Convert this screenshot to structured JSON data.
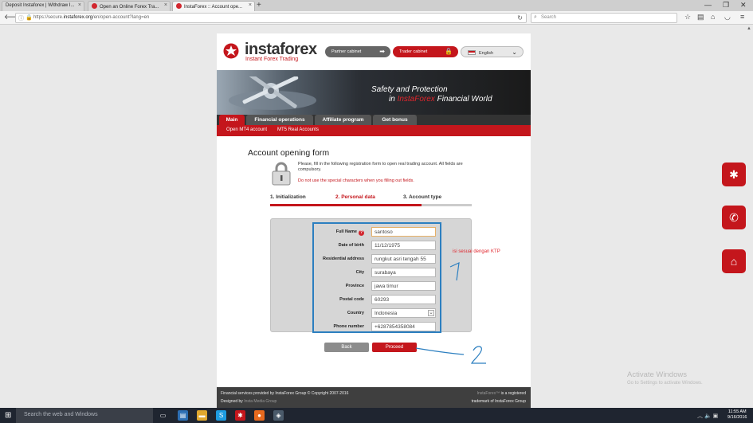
{
  "browser": {
    "tabs": [
      {
        "label": "Deposit Instaforex | Withdraw I..."
      },
      {
        "label": "Open an Online Forex Tra..."
      },
      {
        "label": "InstaForex :: Account ope..."
      }
    ],
    "url_prefix": "https://secure.",
    "url_domain": "instaforex.org",
    "url_path": "/en/open-account?lang=en",
    "search_placeholder": "Search"
  },
  "header": {
    "logo_text": "instaforex",
    "logo_tagline": "Instant Forex Trading",
    "partner_cabinet": "Partner cabinet",
    "trader_cabinet": "Trader cabinet",
    "language": "English"
  },
  "banner": {
    "line1": "Safety and Protection",
    "line2_in": "in ",
    "line2_brand": "InstaForex",
    "line2_rest": " Financial World"
  },
  "menu": {
    "tabs": [
      {
        "label": "Main"
      },
      {
        "label": "Financial operations"
      },
      {
        "label": "Affiliate program"
      },
      {
        "label": "Get bonus"
      }
    ],
    "sub": [
      {
        "label": "Open MT4 account"
      },
      {
        "label": "MT5 Real Accounts"
      }
    ]
  },
  "form": {
    "title": "Account opening form",
    "note": "Please, fill in the following registration form to open real trading account. All fields are compulsory.",
    "warning": "Do not use the special characters when you filling out fields.",
    "steps": [
      {
        "label": "1. Initialization"
      },
      {
        "label": "2. Personal data"
      },
      {
        "label": "3. Account type"
      }
    ],
    "progress_fraction": 0.75,
    "fields": [
      {
        "label": "Full Name",
        "value": "santoso"
      },
      {
        "label": "Date of birth",
        "value": "11/12/1975"
      },
      {
        "label": "Residential address",
        "value": "rungkut asri tengah 55"
      },
      {
        "label": "City",
        "value": "surabaya"
      },
      {
        "label": "Province",
        "value": "jawa timur"
      },
      {
        "label": "Postal code",
        "value": "60293"
      },
      {
        "label": "Country",
        "value": "Indonesia"
      },
      {
        "label": "Phone number",
        "value": "+6287854358084"
      }
    ],
    "back_label": "Back",
    "proceed_label": "Proceed"
  },
  "footer": {
    "left1": "Financial services provided by InstaForex Group © Copyright 2007-2016",
    "left2_prefix": "Designed by ",
    "left2_link": "Insta Media Group",
    "right1_brand": "InstaForex™",
    "right1_rest": " is a registered",
    "right2": "trademark of InstaForex Group"
  },
  "annotations": {
    "note": "isi sesuai dengan KTP",
    "num1": "1",
    "num2": "2"
  },
  "watermark": {
    "line1": "Activate Windows",
    "line2": "Go to Settings to activate Windows."
  },
  "taskbar": {
    "search_placeholder": "Search the web and Windows",
    "time": "11:55 AM",
    "date": "9/16/2016"
  },
  "colors": {
    "brand_red": "#c4161c",
    "annotation_blue": "#2c7fc0"
  }
}
